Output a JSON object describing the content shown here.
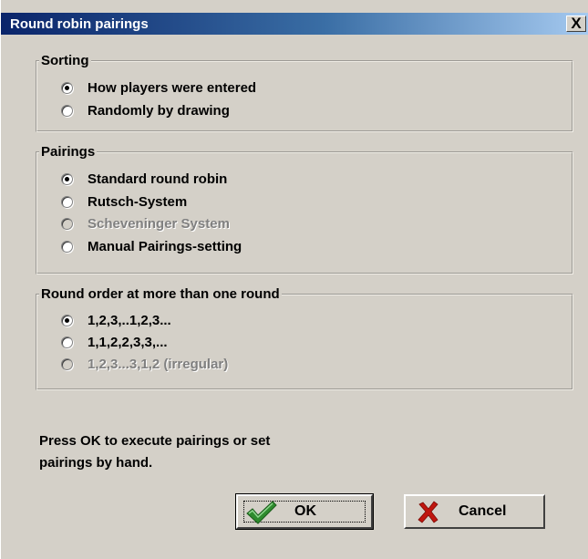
{
  "window": {
    "title": "Round robin pairings",
    "close_glyph": "X"
  },
  "sorting": {
    "legend": "Sorting",
    "options": [
      {
        "label": "How players were entered",
        "checked": true,
        "enabled": true
      },
      {
        "label": "Randomly by drawing",
        "checked": false,
        "enabled": true
      }
    ]
  },
  "pairings": {
    "legend": "Pairings",
    "options": [
      {
        "label": "Standard round robin",
        "checked": true,
        "enabled": true
      },
      {
        "label": "Rutsch-System",
        "checked": false,
        "enabled": true
      },
      {
        "label": "Scheveninger System",
        "checked": false,
        "enabled": false
      },
      {
        "label": "Manual Pairings-setting",
        "checked": false,
        "enabled": true
      }
    ]
  },
  "round_order": {
    "legend": "Round order at more than one round",
    "options": [
      {
        "label": "1,2,3,..1,2,3...",
        "checked": true,
        "enabled": true
      },
      {
        "label": "1,1,2,2,3,3,...",
        "checked": false,
        "enabled": true
      },
      {
        "label": "1,2,3...3,1,2 (irregular)",
        "checked": false,
        "enabled": false
      }
    ]
  },
  "info": {
    "line1": "Press OK to execute pairings or set",
    "line2": "pairings by hand."
  },
  "buttons": {
    "ok_label": "OK",
    "cancel_label": "Cancel"
  },
  "icons": {
    "ok": "checkmark-icon",
    "cancel": "x-icon"
  },
  "colors": {
    "title_start": "#0a246a",
    "title_end": "#a6caf0",
    "face": "#d4d0c8",
    "check_green": "#2e8b2e",
    "cancel_red": "#c0160f"
  }
}
